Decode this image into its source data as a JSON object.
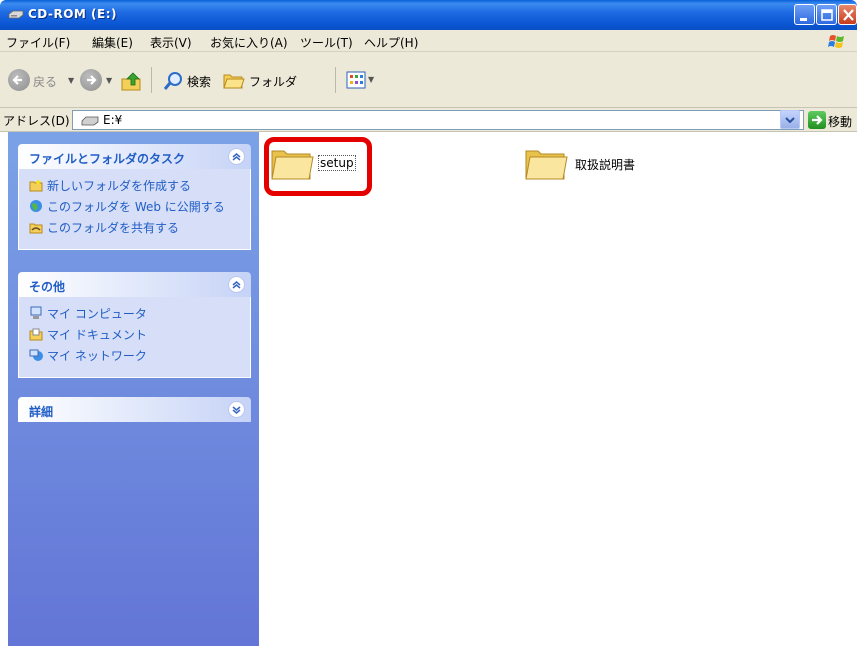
{
  "window": {
    "title": "CD-ROM (E:)"
  },
  "menu": [
    "ファイル(F)",
    "編集(E)",
    "表示(V)",
    "お気に入り(A)",
    "ツール(T)",
    "ヘルプ(H)"
  ],
  "toolbar": {
    "back_label": "戻る",
    "search_label": "検索",
    "folders_label": "フォルダ"
  },
  "address": {
    "label": "アドレス(D)",
    "value": "E:¥",
    "go_label": "移動"
  },
  "left_pane": {
    "file_tasks": {
      "title": "ファイルとフォルダのタスク",
      "items": [
        "新しいフォルダを作成する",
        "このフォルダを Web に公開する",
        "このフォルダを共有する"
      ]
    },
    "other_places": {
      "title": "その他",
      "items": [
        "マイ コンピュータ",
        "マイ ドキュメント",
        "マイ ネットワーク"
      ]
    },
    "details": {
      "title": "詳細"
    }
  },
  "files": [
    {
      "name": "setup",
      "icon": "folder-icon",
      "selected": true
    },
    {
      "name": "取扱説明書",
      "icon": "folder-icon",
      "selected": false
    }
  ],
  "colors": {
    "titlebar": "#0b56d3",
    "pane": "#6f8ee0",
    "link": "#215dc6",
    "highlight": "#e50000"
  }
}
